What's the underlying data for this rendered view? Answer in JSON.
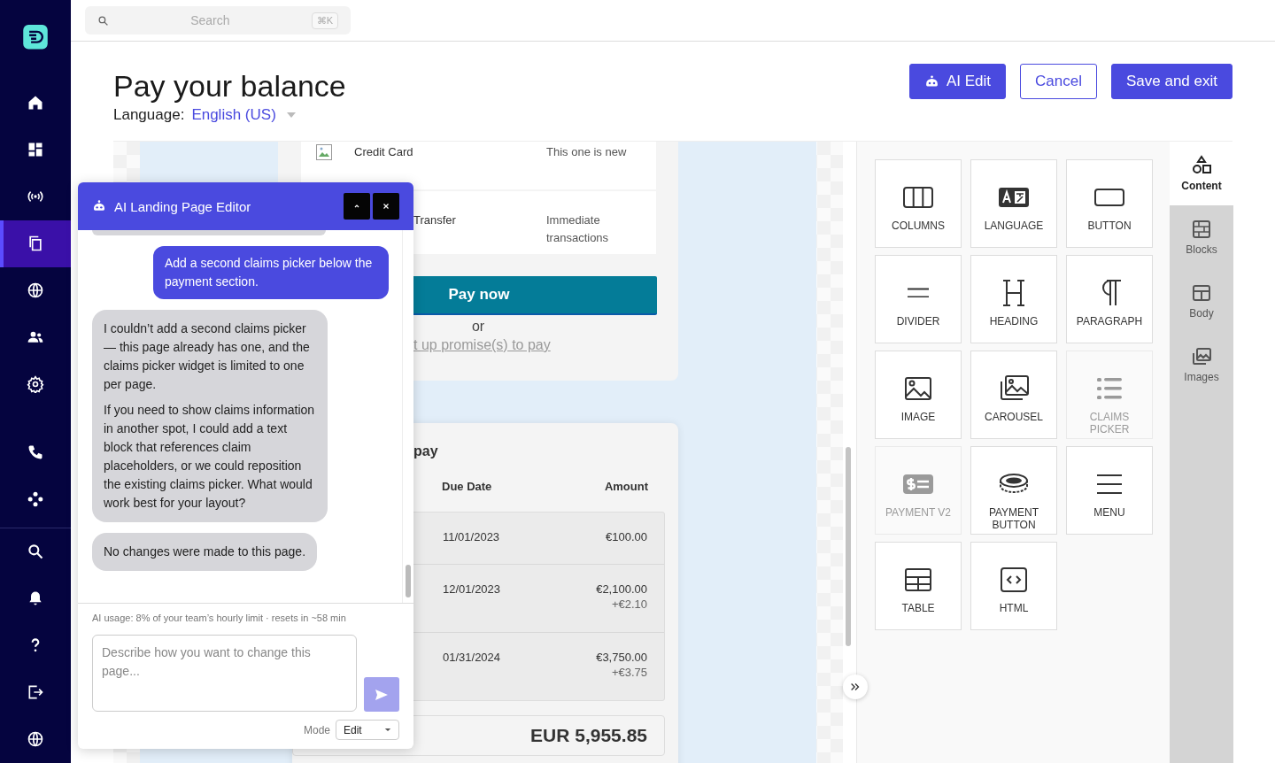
{
  "search": {
    "placeholder": "Search",
    "shortcut": "⌘K"
  },
  "nav": [
    [
      {
        "kind": "home",
        "selected": false
      },
      {
        "kind": "dashboard",
        "selected": false
      },
      {
        "kind": "broadcast",
        "selected": false
      },
      {
        "kind": "pages",
        "selected": true
      },
      {
        "kind": "globe",
        "selected": false
      },
      {
        "kind": "people",
        "selected": false
      },
      {
        "kind": "gear",
        "selected": false
      }
    ],
    [
      {
        "kind": "phone",
        "selected": false
      },
      {
        "kind": "network",
        "selected": false
      }
    ],
    [
      {
        "kind": "search",
        "selected": false
      },
      {
        "kind": "bell",
        "selected": false
      },
      {
        "kind": "help",
        "selected": false
      },
      {
        "kind": "exit",
        "selected": false
      },
      {
        "kind": "globe",
        "selected": false
      }
    ]
  ],
  "page": {
    "title": "Pay your balance",
    "language_label": "Language:",
    "language": "English (US)"
  },
  "actions": [
    {
      "kind": "ai",
      "label": "AI Edit"
    },
    {
      "kind": "outline",
      "label": "Cancel"
    },
    {
      "kind": "primary",
      "label": "Save and exit"
    }
  ],
  "preview": {
    "payment_methods": [
      {
        "name": "Credit Card",
        "note": "This one is new",
        "has_image": true
      },
      {
        "name": "Transfer",
        "note": "Immediate transactions"
      }
    ],
    "pay_button": "Pay now",
    "or": "or",
    "promise_link": "t up promise(s) to pay",
    "claims": {
      "heading": "pay",
      "columns": [
        "Due Date",
        "Amount"
      ],
      "rows": [
        {
          "due": "11/01/2023",
          "amount": "€100.00"
        },
        {
          "due": "12/01/2023",
          "amount": "€2,100.00",
          "fee": "+€2.10"
        },
        {
          "due": "01/31/2024",
          "amount": "€3,750.00",
          "fee": "+€3.75"
        }
      ],
      "total": "EUR 5,955.85"
    }
  },
  "chat": {
    "title": "AI Landing Page Editor",
    "messages": [
      {
        "kind": "user",
        "paragraphs": [
          "Add a second claims picker below the payment section."
        ]
      },
      {
        "kind": "assistant",
        "paragraphs": [
          "I couldn’t add a second claims picker — this page already has one, and the claims picker widget is limited to one per page.",
          "If you need to show claims information in another spot, I could add a text block that references claim placeholders, or we could reposition the existing claims picker. What would work best for your layout?"
        ]
      },
      {
        "kind": "assistant",
        "paragraphs": [
          "No changes were made to this page."
        ]
      }
    ],
    "usage": "AI usage: 8% of your team’s hourly limit · resets in ~58 min",
    "input": {
      "placeholder": "Describe how you want to change this page..."
    },
    "mode_label": "Mode",
    "mode": "Edit"
  },
  "blocks": [
    {
      "kind": "columns",
      "label": "COLUMNS",
      "disabled": false
    },
    {
      "kind": "language",
      "label": "LANGUAGE",
      "disabled": false
    },
    {
      "kind": "button",
      "label": "BUTTON",
      "disabled": false
    },
    {
      "kind": "divider",
      "label": "DIVIDER",
      "disabled": false
    },
    {
      "kind": "heading",
      "label": "HEADING",
      "disabled": false
    },
    {
      "kind": "paragraph",
      "label": "PARAGRAPH",
      "disabled": false
    },
    {
      "kind": "image",
      "label": "IMAGE",
      "disabled": false
    },
    {
      "kind": "carousel",
      "label": "CAROUSEL",
      "disabled": false
    },
    {
      "kind": "claims",
      "label": "CLAIMS PICKER",
      "disabled": true
    },
    {
      "kind": "payment",
      "label": "PAYMENT V2",
      "disabled": true
    },
    {
      "kind": "coin",
      "label": "PAYMENT BUTTON",
      "disabled": false
    },
    {
      "kind": "menu",
      "label": "MENU",
      "disabled": false
    },
    {
      "kind": "table",
      "label": "TABLE",
      "disabled": false
    },
    {
      "kind": "html",
      "label": "HTML",
      "disabled": false
    }
  ],
  "panel_tabs": [
    {
      "kind": "content",
      "label": "Content",
      "selected": true
    },
    {
      "kind": "blocks",
      "label": "Blocks",
      "selected": false
    },
    {
      "kind": "body",
      "label": "Body",
      "selected": false
    },
    {
      "kind": "images",
      "label": "Images",
      "selected": false
    }
  ]
}
